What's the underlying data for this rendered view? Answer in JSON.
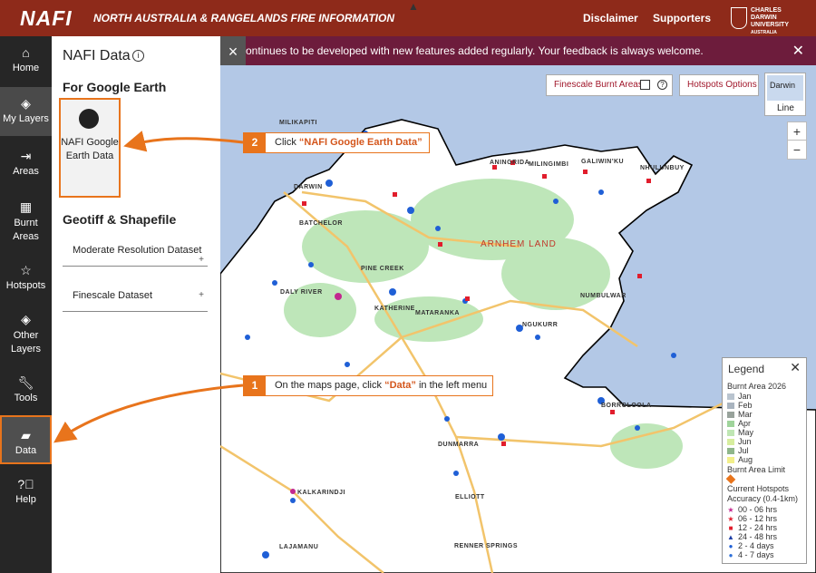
{
  "header": {
    "logo": "NAFI",
    "subtitle": "NORTH AUSTRALIA & RANGELANDS FIRE INFORMATION",
    "nav": [
      "Disclaimer",
      "Supporters"
    ],
    "university": [
      "CHARLES",
      "DARWIN",
      "UNIVERSITY",
      "AUSTRALIA"
    ]
  },
  "sidebar": {
    "items": [
      {
        "icon": "home-icon",
        "label": "Home"
      },
      {
        "icon": "layers-icon",
        "label": "My Layers"
      },
      {
        "icon": "areas-icon",
        "label": "Areas"
      },
      {
        "icon": "grid-icon",
        "label": "Burnt Areas"
      },
      {
        "icon": "star-icon",
        "label": "Hotspots"
      },
      {
        "icon": "stack-icon",
        "label": "Other Layers"
      },
      {
        "icon": "wrench-icon",
        "label": "Tools"
      },
      {
        "icon": "folder-icon",
        "label": "Data"
      },
      {
        "icon": "help-icon",
        "label": "Help"
      }
    ]
  },
  "panel": {
    "title": "NAFI Data",
    "section_google": "For Google Earth",
    "ge_button": "NAFI Google Earth Data",
    "section_geotiff": "Geotiff & Shapefile",
    "datasets": [
      "Moderate Resolution Dataset",
      "Finescale Dataset"
    ],
    "plus": "+"
  },
  "banner": {
    "text": "ontinues to be developed with new features added regularly. Your feedback is always welcome.",
    "close": "✕"
  },
  "map": {
    "finescale_label": "Finescale Burnt Areas",
    "hotspot_options": "Hotspots Options",
    "basemap_label": "Line",
    "basemap_thumb": "Darwin",
    "zoom_in": "+",
    "zoom_out": "−",
    "places": [
      "MILIKAPITI",
      "ANINGRIDA",
      "MILINGIMBI",
      "GALIWIN'KU",
      "NHULUNBUY",
      "DARWIN",
      "BATCHELOR",
      "DALY RIVER",
      "PINE CREEK",
      "KATHERINE",
      "MATARANKA",
      "NUMBULWAR",
      "NGUKURR",
      "BORROLOOLA",
      "DUNMARRA",
      "ELLIOTT",
      "KALKARINDJI",
      "LAJAMANU",
      "RENNER SPRINGS"
    ],
    "region": "ARNHEM LAND"
  },
  "callouts": [
    {
      "num": "2",
      "pre": "Click ",
      "hl": "“NAFI Google Earth Data”",
      "post": ""
    },
    {
      "num": "1",
      "pre": "On the maps page, click ",
      "hl": "“Data”",
      "post": " in the left menu"
    }
  ],
  "legend": {
    "title": "Legend",
    "close": "✕",
    "burnt_title": "Burnt Area 2026",
    "months": [
      {
        "label": "Jan",
        "color": "#b9c4cf"
      },
      {
        "label": "Feb",
        "color": "#a9b4bf"
      },
      {
        "label": "Mar",
        "color": "#98a29b"
      },
      {
        "label": "Apr",
        "color": "#9fd49b"
      },
      {
        "label": "May",
        "color": "#bfe6b3"
      },
      {
        "label": "Jun",
        "color": "#d7ee9e"
      },
      {
        "label": "Jul",
        "color": "#8fb68a"
      },
      {
        "label": "Aug",
        "color": "#f2ef8a"
      }
    ],
    "limit": "Burnt Area Limit",
    "limit_color": "#e8741c",
    "hotspots_title": "Current Hotspots",
    "accuracy": "Accuracy (0.4-1km)",
    "hotspots": [
      {
        "label": "00 - 06 hrs",
        "color": "#c2278f",
        "shape": "★"
      },
      {
        "label": "06 - 12 hrs",
        "color": "#e11d2c",
        "shape": "★"
      },
      {
        "label": "12 - 24 hrs",
        "color": "#e11d2c",
        "shape": "■"
      },
      {
        "label": "24 - 48 hrs",
        "color": "#1f3fa6",
        "shape": "▲"
      },
      {
        "label": "2 - 4 days",
        "color": "#1f5fd6",
        "shape": "●"
      },
      {
        "label": "4 - 7 days",
        "color": "#2c6fd9",
        "shape": "●"
      }
    ]
  }
}
